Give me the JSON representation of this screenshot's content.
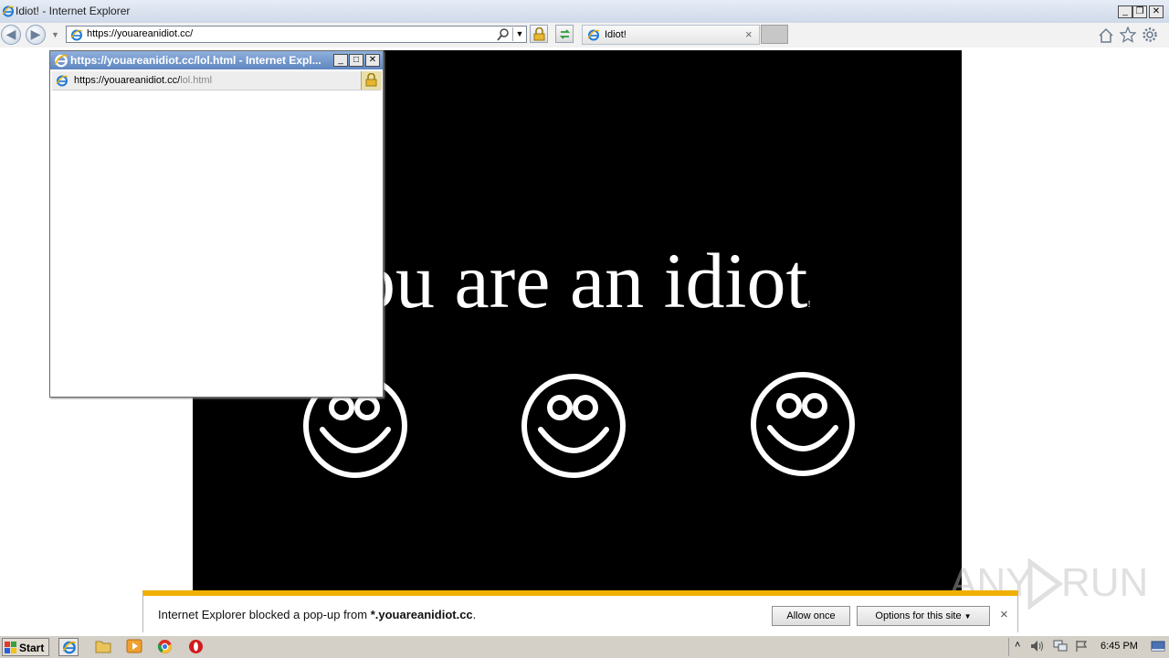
{
  "browser": {
    "window_title": "Idiot! - Internet Explorer",
    "address_url": "https://youareanidiot.cc/",
    "tab_label": "Idiot!",
    "tab_close": "×"
  },
  "page": {
    "headline": "ou are an idiot",
    "trailing_mark": "!",
    "background": "#000000",
    "text_color": "#ffffff",
    "smileys": [
      "smiley-face",
      "smiley-face",
      "smiley-face"
    ]
  },
  "popup": {
    "title": "https://youareanidiot.cc/lol.html - Internet Expl...",
    "address_prefix": "https://youareanidiot.cc/",
    "address_path": "lol.html"
  },
  "notification": {
    "message_prefix": "Internet Explorer blocked a pop-up from ",
    "message_site": "*.youareanidiot.cc",
    "message_suffix": ".",
    "allow_once": "Allow once",
    "options": "Options for this site",
    "close": "×",
    "accent": "#f0b000"
  },
  "watermark": {
    "left": "ANY",
    "right": "RUN"
  },
  "taskbar": {
    "start_label": "Start",
    "clock": "6:45 PM"
  }
}
